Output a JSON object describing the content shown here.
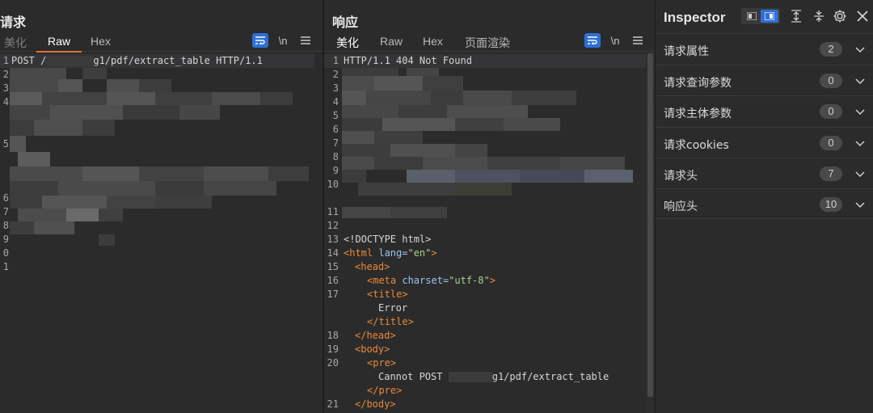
{
  "request": {
    "title": "请求",
    "tabs": [
      "美化",
      "Raw",
      "Hex"
    ],
    "active_tab": "Raw",
    "wrap_icon": "wrap-lines-icon",
    "newline_label": "\\n",
    "menu_icon": "hamburger-menu-icon",
    "line_numbers": [
      "1",
      "2",
      "3",
      "4",
      "5",
      "6",
      "7",
      "8",
      "9",
      "0",
      "1"
    ],
    "first_line_prefix": "POST /",
    "first_line_suffix": "g1/pdf/extract_table HTTP/1.1"
  },
  "response": {
    "title": "响应",
    "tabs": [
      "美化",
      "Raw",
      "Hex",
      "页面渲染"
    ],
    "active_tab": "美化",
    "newline_label": "\\n",
    "line_numbers": [
      "1",
      "2",
      "3",
      "4",
      "5",
      "6",
      "7",
      "8",
      "9",
      "10",
      "11",
      "12",
      "13",
      "14",
      "15",
      "16",
      "17",
      "18",
      "19",
      "20",
      "21"
    ],
    "status_line": "HTTP/1.1 404 Not Found",
    "html_lines": {
      "doctype": "<!DOCTYPE html>",
      "html_open_tag": "<html",
      "lang_attr": "lang=",
      "lang_val": "\"en\"",
      "html_open_end": ">",
      "head_open": "<head>",
      "meta_tag": "<meta",
      "charset_attr": "charset=",
      "charset_val": "\"utf-8\"",
      "meta_end": ">",
      "title_open": "<title>",
      "title_text": "Error",
      "title_close": "</title>",
      "head_close": "</head>",
      "body_open": "<body>",
      "pre_open": "<pre>",
      "pre_text_prefix": "Cannot POST",
      "pre_text_suffix": "g1/pdf/extract_table",
      "pre_close": "</pre>",
      "body_close": "</body>"
    }
  },
  "inspector": {
    "title": "Inspector",
    "rows": [
      {
        "label": "请求属性",
        "count": "2"
      },
      {
        "label": "请求查询参数",
        "count": "0"
      },
      {
        "label": "请求主体参数",
        "count": "0"
      },
      {
        "label": "请求cookies",
        "count": "0"
      },
      {
        "label": "请求头",
        "count": "7"
      },
      {
        "label": "响应头",
        "count": "10"
      }
    ]
  },
  "colors": {
    "accent_blue": "#2f6fd6",
    "tab_underline": "#e2703a",
    "tag_orange": "#e88a3b",
    "attr_blue": "#9cc4f0",
    "value_green": "#a6d28a"
  }
}
